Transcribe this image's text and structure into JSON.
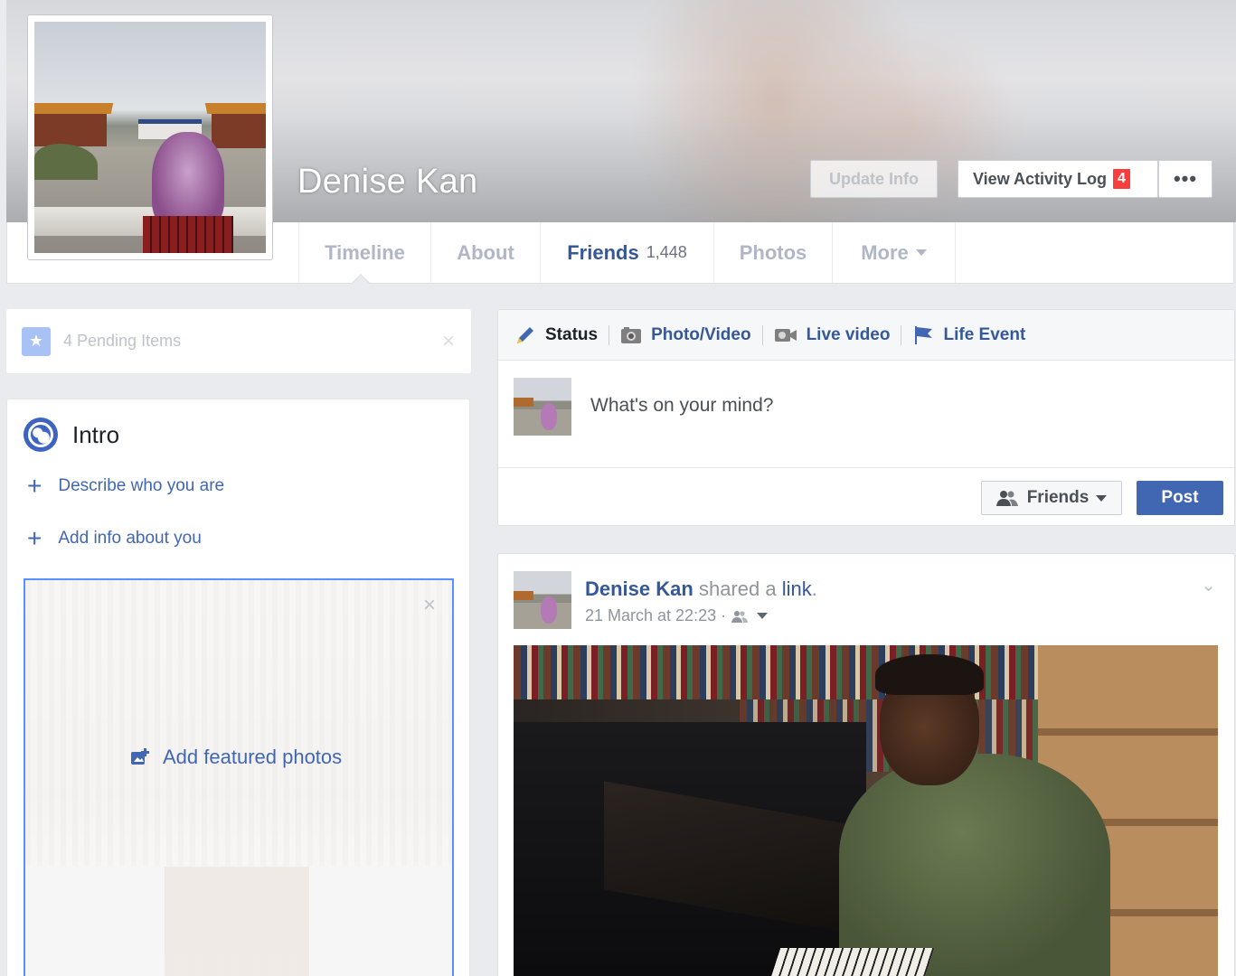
{
  "profile": {
    "name": "Denise Kan",
    "update_info": "Update Info",
    "view_activity_log": "View Activity Log",
    "activity_count": "4",
    "more_dots": "•••"
  },
  "tabs": [
    {
      "label": "Timeline"
    },
    {
      "label": "About"
    },
    {
      "label": "Friends",
      "count": "1,448"
    },
    {
      "label": "Photos"
    },
    {
      "label": "More"
    }
  ],
  "pending": {
    "text": "4 Pending Items",
    "close": "×"
  },
  "intro": {
    "title": "Intro",
    "links": [
      "Describe who you are",
      "Add info about you"
    ],
    "plus": "+",
    "featured_label": "Add featured photos",
    "featured_close": "×"
  },
  "composer": {
    "tabs": [
      "Status",
      "Photo/Video",
      "Live video",
      "Life Event"
    ],
    "placeholder": "What's on your mind?",
    "audience": "Friends",
    "post_label": "Post"
  },
  "post": {
    "author": "Denise Kan",
    "action": "shared a",
    "object": "link",
    "period": ".",
    "timestamp": "21 March at 22:23 ·",
    "chevron": "⌄"
  },
  "colors": {
    "brand": "#4267b2",
    "link": "#365899",
    "badge": "#fa3e3e",
    "page_bg": "#e9ebee"
  }
}
